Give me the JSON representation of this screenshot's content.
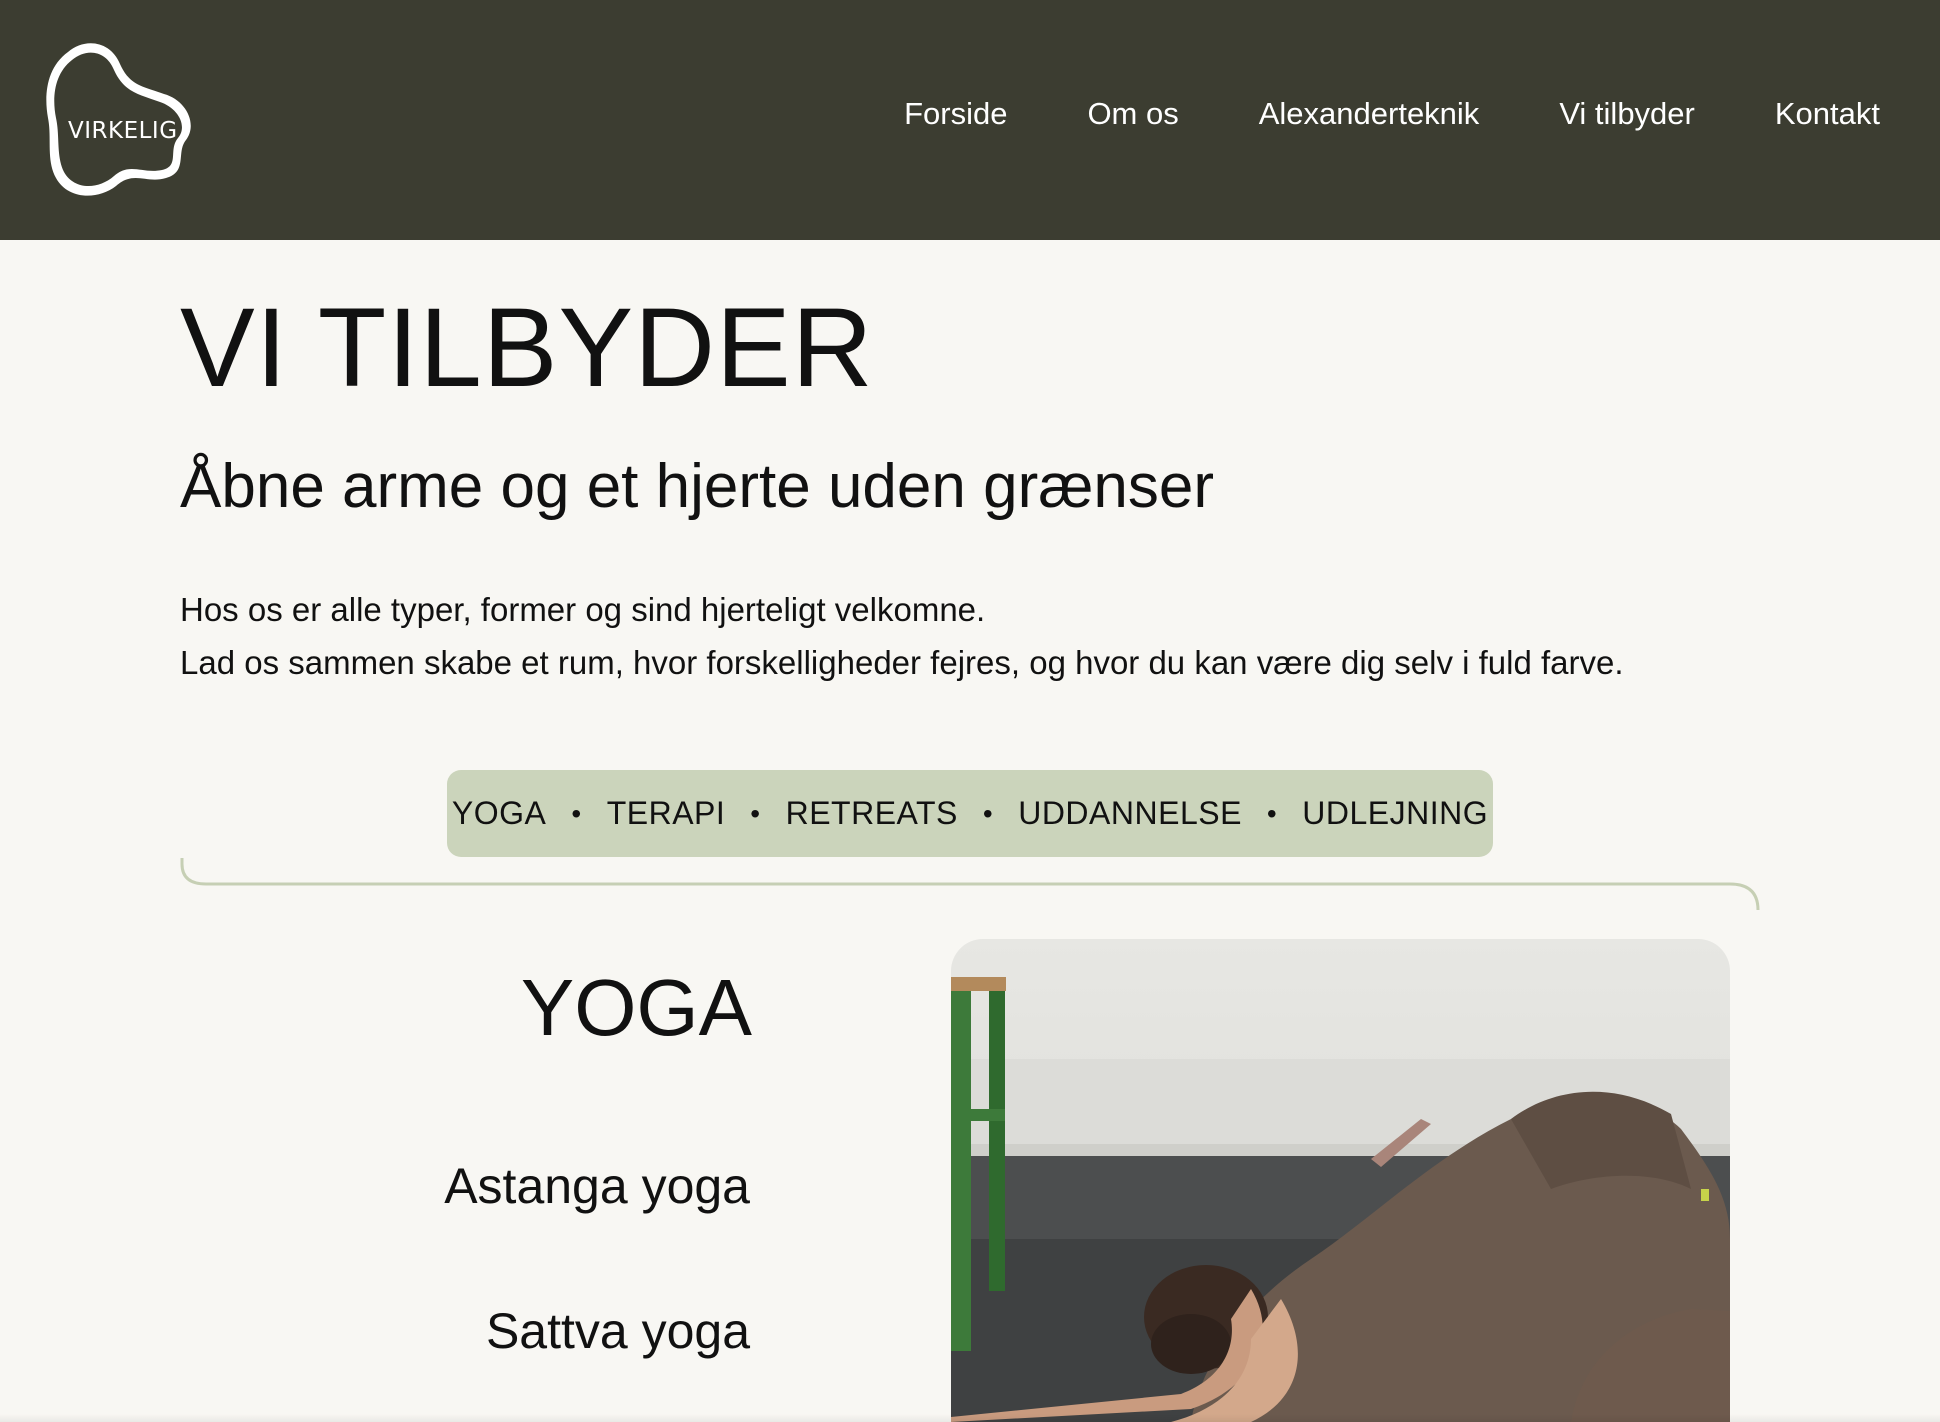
{
  "logo": {
    "text": "VIRKELIG",
    "icon": "blob-logo-icon"
  },
  "nav": {
    "items": [
      {
        "label": "Forside"
      },
      {
        "label": "Om os"
      },
      {
        "label": "Alexanderteknik"
      },
      {
        "label": "Vi tilbyder"
      },
      {
        "label": "Kontakt"
      }
    ]
  },
  "page": {
    "title": "VI TILBYDER",
    "subtitle": "Åbne arme og et hjerte uden grænser",
    "intro_line1": "Hos os er alle typer, former og sind hjerteligt velkomne.",
    "intro_line2": "Lad os sammen skabe et rum, hvor forskelligheder fejres, og hvor du kan være dig selv i fuld farve."
  },
  "services": {
    "separator": "•",
    "items": [
      {
        "label": "YOGA"
      },
      {
        "label": "TERAPI"
      },
      {
        "label": "RETREATS"
      },
      {
        "label": "UDDANNELSE"
      },
      {
        "label": "UDLEJNING"
      }
    ]
  },
  "yoga": {
    "title": "YOGA",
    "items": [
      {
        "label": "Astanga yoga"
      },
      {
        "label": "Sattva yoga"
      }
    ]
  },
  "colors": {
    "header_bg": "#3c3d31",
    "page_bg": "#f8f7f3",
    "pill_bg": "#cbd4bb",
    "divider": "#c6cfb4"
  }
}
